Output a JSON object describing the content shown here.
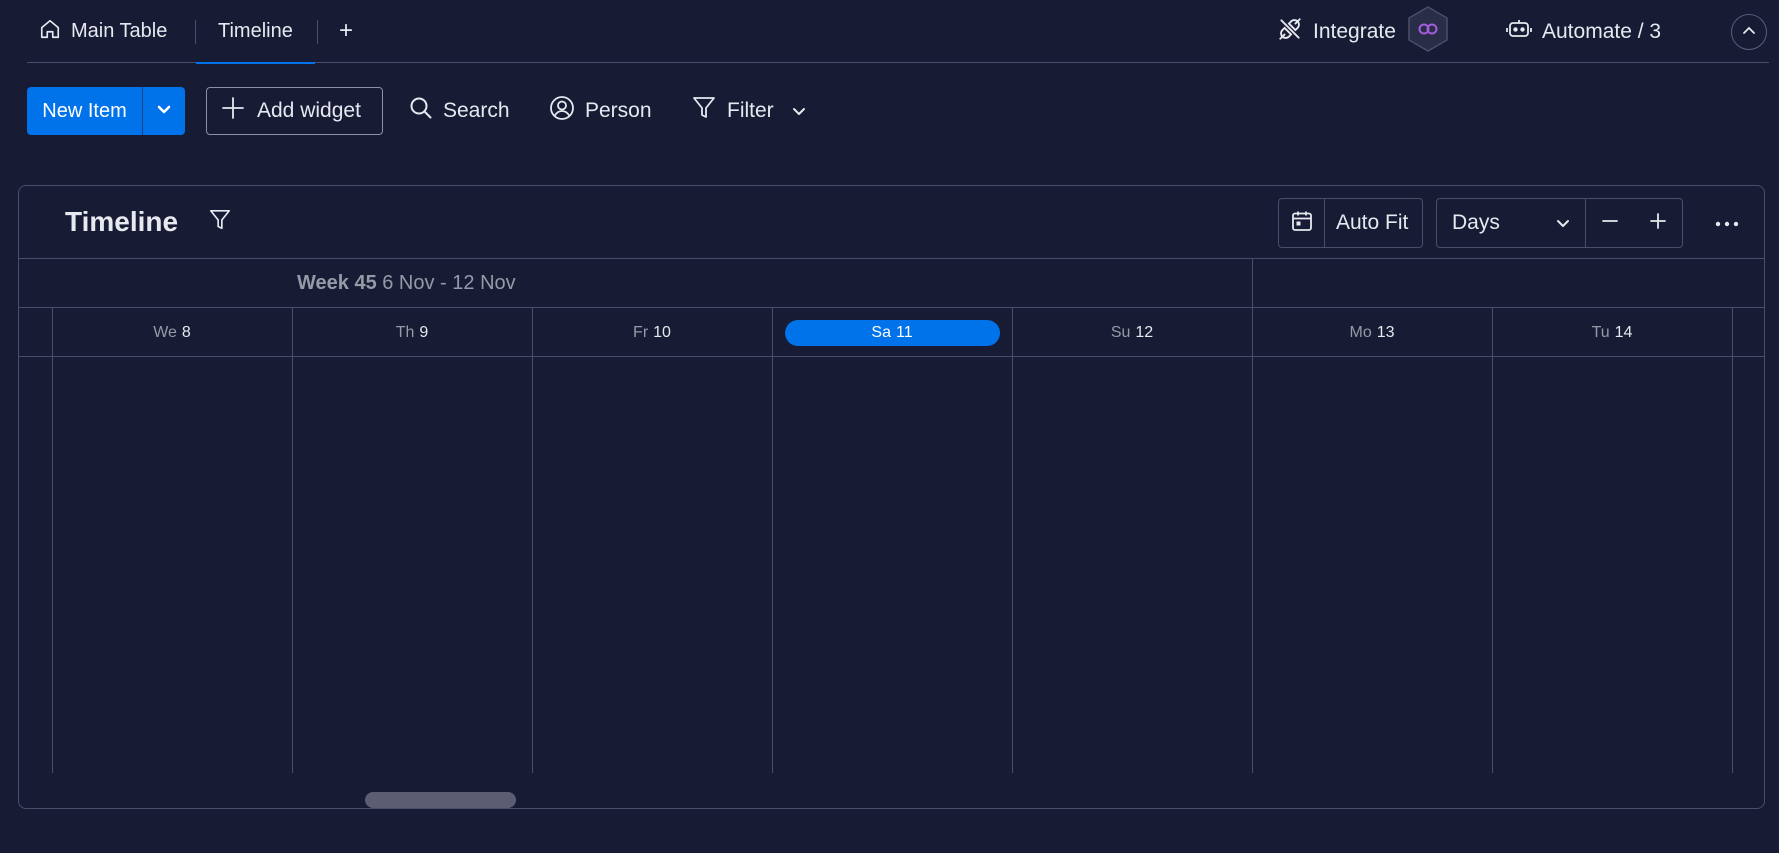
{
  "views": {
    "tabs": [
      {
        "label": "Main Table",
        "icon": "home-icon"
      },
      {
        "label": "Timeline"
      }
    ],
    "add_label": "+",
    "integrate_label": "Integrate",
    "automate_label": "Automate / 3"
  },
  "toolbar": {
    "new_item_label": "New Item",
    "add_widget_label": "Add widget",
    "search_label": "Search",
    "person_label": "Person",
    "filter_label": "Filter"
  },
  "timeline": {
    "title": "Timeline",
    "autofit_label": "Auto Fit",
    "scale_label": "Days",
    "week_title": "Week 45",
    "week_range": "6 Nov - 12 Nov",
    "days": [
      {
        "name": "We",
        "num": "8"
      },
      {
        "name": "Th",
        "num": "9"
      },
      {
        "name": "Fr",
        "num": "10"
      },
      {
        "name": "Sa",
        "num": "11",
        "today": true
      },
      {
        "name": "Su",
        "num": "12"
      },
      {
        "name": "Mo",
        "num": "13"
      },
      {
        "name": "Tu",
        "num": "14"
      }
    ]
  },
  "colors": {
    "background": "#181b34",
    "primary": "#0073ea",
    "border": "#4b4e69",
    "integrate_accent": "#a25ddc"
  }
}
